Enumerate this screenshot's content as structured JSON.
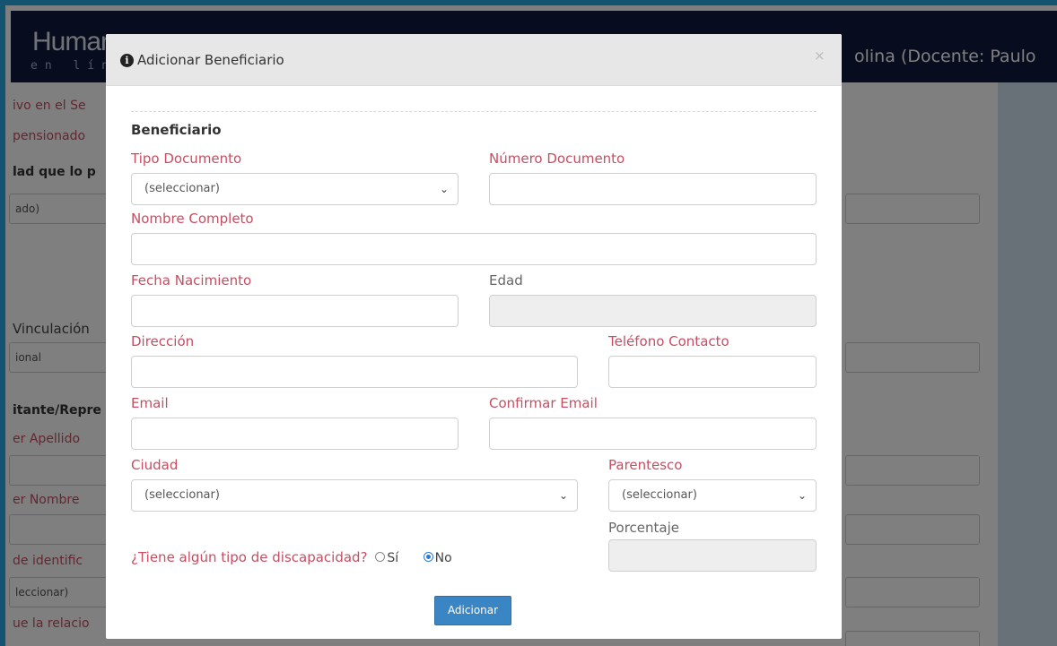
{
  "header": {
    "logo_main": "Humano",
    "logo_sub": "en línea",
    "user": "olina (Docente: Paulo"
  },
  "background": {
    "labels": [
      "ivo en el Se",
      "pensionado",
      "lad que lo p",
      "Vinculación",
      "itante/Repre",
      "er Apellido",
      "er Nombre",
      "de identific",
      "ue la relacio"
    ],
    "inputs": [
      "ado)",
      "ional",
      "leccionar)"
    ]
  },
  "modal": {
    "title": "Adicionar Beneficiario",
    "close": "×",
    "section": "Beneficiario",
    "tipo_documento": {
      "label": "Tipo Documento",
      "value": "(seleccionar)"
    },
    "numero_documento": {
      "label": "Número Documento",
      "value": ""
    },
    "nombre_completo": {
      "label": "Nombre Completo",
      "value": ""
    },
    "fecha_nacimiento": {
      "label": "Fecha Nacimiento",
      "value": ""
    },
    "edad": {
      "label": "Edad",
      "value": ""
    },
    "direccion": {
      "label": "Dirección",
      "value": ""
    },
    "telefono": {
      "label": "Teléfono Contacto",
      "value": ""
    },
    "email": {
      "label": "Email",
      "value": ""
    },
    "confirmar_email": {
      "label": "Confirmar Email",
      "value": ""
    },
    "ciudad": {
      "label": "Ciudad",
      "value": "(seleccionar)"
    },
    "parentesco": {
      "label": "Parentesco",
      "value": "(seleccionar)"
    },
    "porcentaje": {
      "label": "Porcentaje",
      "value": ""
    },
    "discapacidad": {
      "question": "¿Tiene algún tipo de discapacidad?",
      "option_si": "Sí",
      "option_no": "No",
      "selected": "No"
    },
    "submit_label": "Adicionar"
  }
}
